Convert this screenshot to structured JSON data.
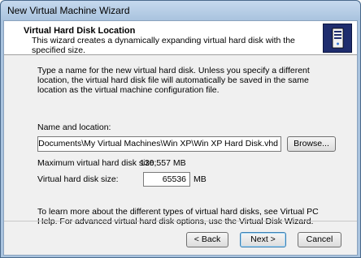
{
  "window": {
    "title": "New Virtual Machine Wizard"
  },
  "header": {
    "title": "Virtual Hard Disk Location",
    "description": "This wizard creates a dynamically expanding virtual hard disk with the specified size.",
    "icon": "virtual-machine-icon"
  },
  "body": {
    "intro": "Type a name for the new virtual hard disk. Unless you specify a different location, the virtual hard disk file will automatically be saved in the same location as the virtual machine configuration file.",
    "name_label": "Name and location:",
    "path_value": "C:\\Users\\Penelope\\Documents\\My Virtual Machines\\Win XP\\Win XP Hard Disk.vhd",
    "browse_label": "Browse...",
    "max_size_label": "Maximum virtual hard disk size:",
    "max_size_value": "130,557 MB",
    "vsize_label": "Virtual hard disk size:",
    "vsize_value": "65536",
    "vsize_unit": "MB",
    "learn_more": "To learn more about the different types of virtual hard disks, see Virtual PC Help. For advanced virtual hard disk options, use the Virtual Disk Wizard."
  },
  "footer": {
    "back_label": "< Back",
    "next_label": "Next >",
    "cancel_label": "Cancel"
  }
}
